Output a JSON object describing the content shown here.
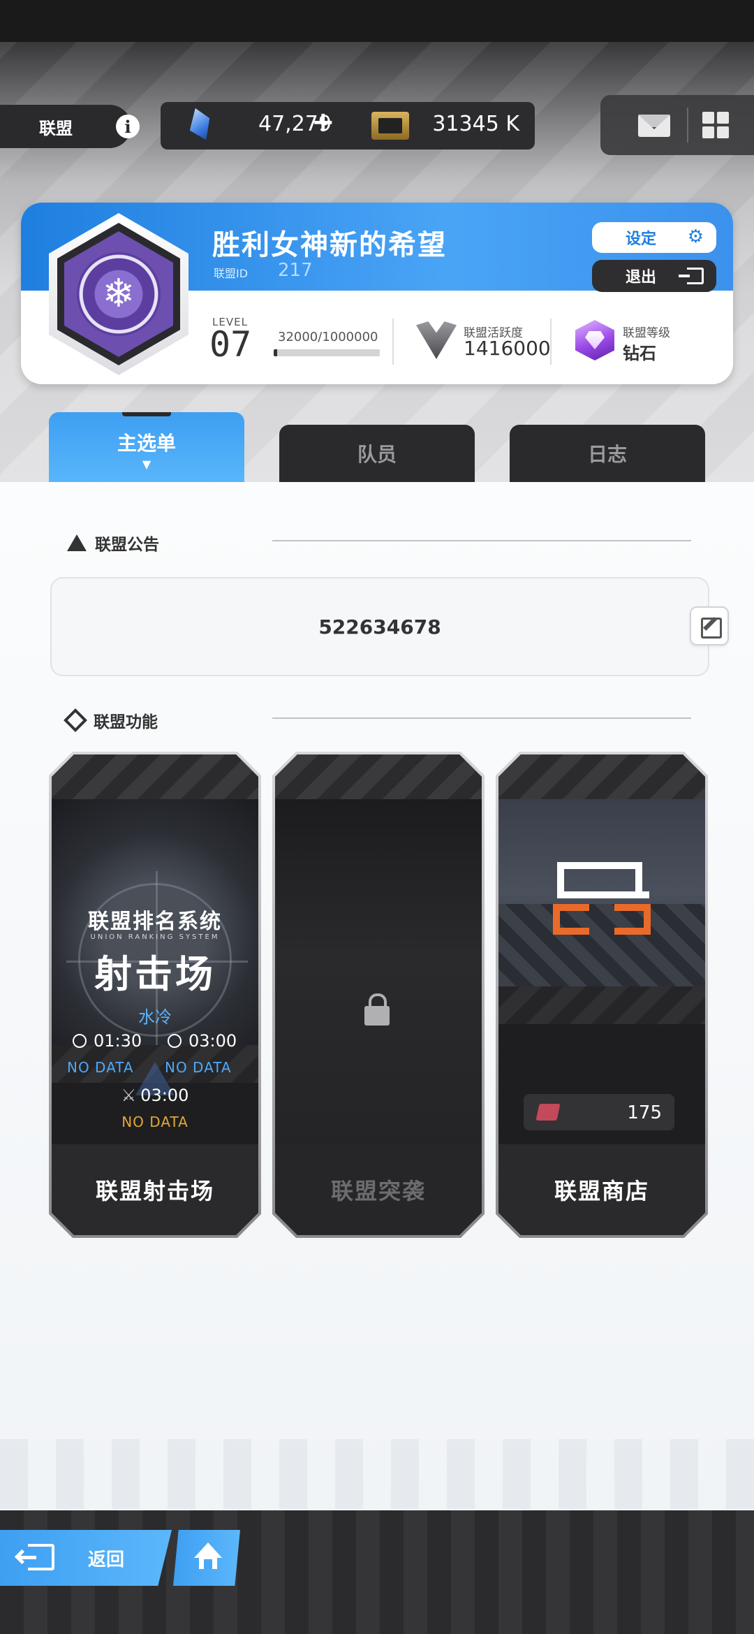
{
  "header": {
    "alliance_tab": "联盟",
    "info_icon": "info-icon",
    "gems": "47,279",
    "plus": "+",
    "tickets": "31345 K",
    "mail_icon": "mail-icon",
    "menu_icon": "grid-icon"
  },
  "alliance": {
    "name": "胜利女神新的希望",
    "id_label": "联盟ID",
    "id_value": "217",
    "settings_label": "设定",
    "exit_label": "退出",
    "level_label": "LEVEL",
    "level_value": "07",
    "exp_text": "32000/1000000",
    "exp_progress": 0.032,
    "activity_label": "联盟活跃度",
    "activity_value": "1416000",
    "rank_label": "联盟等级",
    "rank_value": "钻石"
  },
  "tabs": [
    {
      "label": "主选单",
      "active": true
    },
    {
      "label": "队员",
      "active": false
    },
    {
      "label": "日志",
      "active": false
    }
  ],
  "notice": {
    "title": "联盟公告",
    "text": "522634678"
  },
  "features": {
    "title": "联盟功能",
    "cards": [
      {
        "art_title_line1": "联盟排名系统",
        "art_title_en": "UNION RANKING SYSTEM",
        "art_title_line2": "射击场",
        "element": "水冷",
        "time1": "01:30",
        "time2": "03:00",
        "time1_status": "NO DATA",
        "time2_status": "NO DATA",
        "boss_time": "03:00",
        "boss_status": "NO DATA",
        "label": "联盟射击场"
      },
      {
        "label": "联盟突袭",
        "locked": true
      },
      {
        "coin_value": "175",
        "label": "联盟商店"
      }
    ]
  },
  "bottom": {
    "back_label": "返回"
  },
  "colors": {
    "accent_blue": "#3e9ff2",
    "dark_panel": "#2a2a2c",
    "no_data_blue": "#4fa8f8",
    "no_data_gold": "#e0a83a",
    "shop_orange": "#ea6a2a"
  }
}
